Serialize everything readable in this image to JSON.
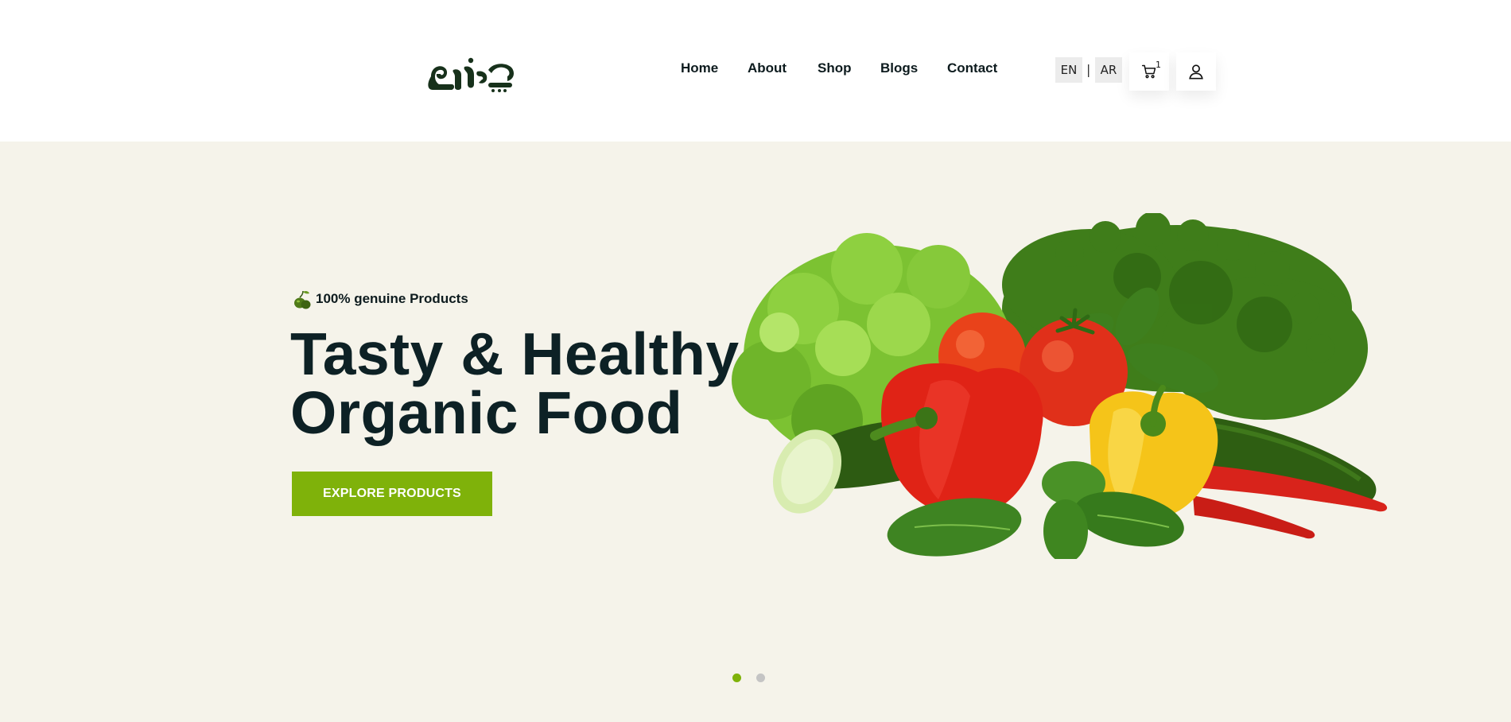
{
  "header": {
    "logo_text": "مزارع المدينة",
    "nav": [
      {
        "label": "Home"
      },
      {
        "label": "About"
      },
      {
        "label": "Shop"
      },
      {
        "label": "Blogs"
      },
      {
        "label": "Contact"
      }
    ],
    "lang": {
      "en": "EN",
      "separator": "|",
      "ar": "AR"
    },
    "cart": {
      "icon": "cart-icon",
      "count": "1"
    },
    "user": {
      "icon": "user-icon"
    }
  },
  "hero": {
    "badge_icon": "olive-icon",
    "badge_text": "100% genuine Products",
    "title_line1": "Tasty & Healthy",
    "title_line2": "Organic Food",
    "cta_label": "EXPLORE PRODUCTS",
    "image": "vegetables-image",
    "slides": {
      "total": 2,
      "active": 1
    }
  },
  "colors": {
    "accent": "#7fb20a",
    "hero_bg": "#f5f3ea",
    "title": "#0d2125",
    "logo": "#17311b"
  }
}
